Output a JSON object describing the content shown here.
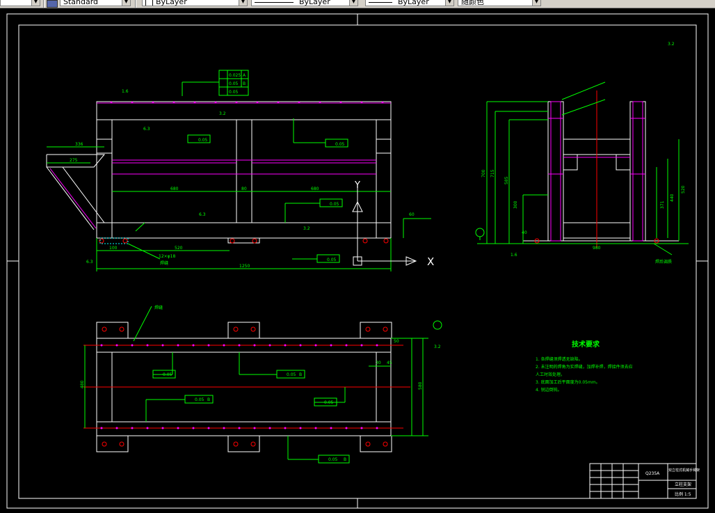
{
  "toolbar": {
    "combo1_value": "",
    "textstyle_value": "Standard",
    "layer_value": "ByLayer",
    "linetype_value": "ByLayer",
    "lineweight_value": "ByLayer",
    "color_value": "随颜色"
  },
  "drawing": {
    "front_view": {
      "gdt_top_rows": [
        "0.025",
        "0.05",
        "0.05"
      ],
      "gdt_top_datums": [
        "A",
        "B",
        ""
      ],
      "roughness_top": "1.6",
      "roughness_a": "6.3",
      "roughness_b": "3.2",
      "roughness_c": "6.3",
      "roughness_d": "3.2",
      "roughness_left": "6.3",
      "flatness_1": "0.05",
      "flatness_2": "0.05",
      "flatness_3": "0.05",
      "flatness_4": "0.05",
      "dim_336": "336",
      "dim_275": "275",
      "dim_680_left": "680",
      "dim_80": "80",
      "dim_680_right": "680",
      "dim_100": "100",
      "dim_520": "520",
      "dim_1250": "1250",
      "dim_12_10": "12×φ18",
      "label_weld": "焊缝",
      "label_60": "60",
      "label_axis_y": "Y",
      "label_axis_x": "X"
    },
    "side_view": {
      "roughness_top": "3.2",
      "dim_700": "700",
      "dim_715": "715",
      "dim_585": "585",
      "dim_300": "300",
      "dim_40": "40",
      "dim_980": "980",
      "dim_371": "371",
      "dim_440": "440",
      "dim_520": "520",
      "label_bottom": "焊后调质",
      "roughness_bottom": "1.6"
    },
    "top_view": {
      "label_weld": "焊缝",
      "flatness_1": "0.05",
      "parallel_1": "0.05",
      "parallel_1_datum": "B",
      "parallel_2": "0.05",
      "parallel_2_datum": "B",
      "flatness_2": "0.05",
      "parallel_3": "0.05",
      "parallel_3_datum": "B",
      "dim_480": "480",
      "dim_580": "580",
      "dim_50": "50",
      "dim_30": "30",
      "dim_45": "45",
      "roughness": "3.2"
    },
    "tech_req": {
      "title": "技术要求",
      "items": [
        "1. 各焊缝须焊透无缺陷。",
        "2. 未注明的焊角为实焊缝，加焊补焊，焊接件须去应",
        "   人工时效处理。",
        "3. 底面加工后平面度为0.05mm。",
        "4. 锐边倒钝。"
      ]
    },
    "title_block": {
      "material": "Q235A",
      "name": "双立柱式机械手臂架",
      "part": "立柱支架",
      "scale": "比例 1:5"
    }
  },
  "colors": {
    "background": "#000000",
    "frame": "#ffffff",
    "dimension": "#00ff00",
    "outline": "#ffffff",
    "hidden": "#ff00ff",
    "center": "#ff0000",
    "hatch": "#00ffff"
  }
}
